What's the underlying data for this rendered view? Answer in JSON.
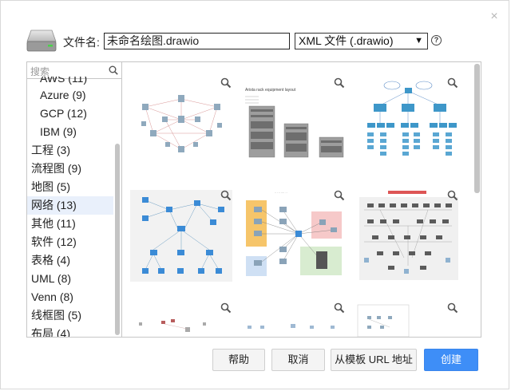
{
  "dialog": {
    "filename_label": "文件名:",
    "filename_value": "未命名绘图.drawio",
    "format_selected": "XML 文件 (.drawio)",
    "close_glyph": "×",
    "help_glyph": "?"
  },
  "search": {
    "placeholder": "搜索"
  },
  "categories": [
    {
      "label": "AWS (11)",
      "sub": true,
      "clip": true
    },
    {
      "label": "Azure (9)",
      "sub": true
    },
    {
      "label": "GCP (12)",
      "sub": true
    },
    {
      "label": "IBM (9)",
      "sub": true
    },
    {
      "label": "工程 (3)"
    },
    {
      "label": "流程图 (9)"
    },
    {
      "label": "地图 (5)"
    },
    {
      "label": "网络 (13)",
      "selected": true
    },
    {
      "label": "其他 (11)"
    },
    {
      "label": "软件 (12)"
    },
    {
      "label": "表格 (4)"
    },
    {
      "label": "UML (8)"
    },
    {
      "label": "Venn (8)"
    },
    {
      "label": "线框图 (5)"
    },
    {
      "label": "布局 (4)"
    }
  ],
  "templates": [
    {
      "name": "network-template-1"
    },
    {
      "name": "network-template-2",
      "caption": "Arista rack equipment layout"
    },
    {
      "name": "network-template-3"
    },
    {
      "name": "network-template-4"
    },
    {
      "name": "network-template-5"
    },
    {
      "name": "network-template-6"
    },
    {
      "name": "network-template-7"
    },
    {
      "name": "network-template-8"
    },
    {
      "name": "network-template-9"
    }
  ],
  "buttons": {
    "help": "帮助",
    "cancel": "取消",
    "from_template_url": "从模板 URL 地址",
    "create": "创建"
  },
  "icons": {
    "drive": "hard-drive-icon",
    "search": "search-icon",
    "zoom": "magnifier-icon",
    "close": "close-icon",
    "help": "help-circle-icon"
  },
  "colors": {
    "primary": "#3e8ef7",
    "selected_row": "#e9f0fb",
    "thumb_blue": "#3b8bd6"
  }
}
